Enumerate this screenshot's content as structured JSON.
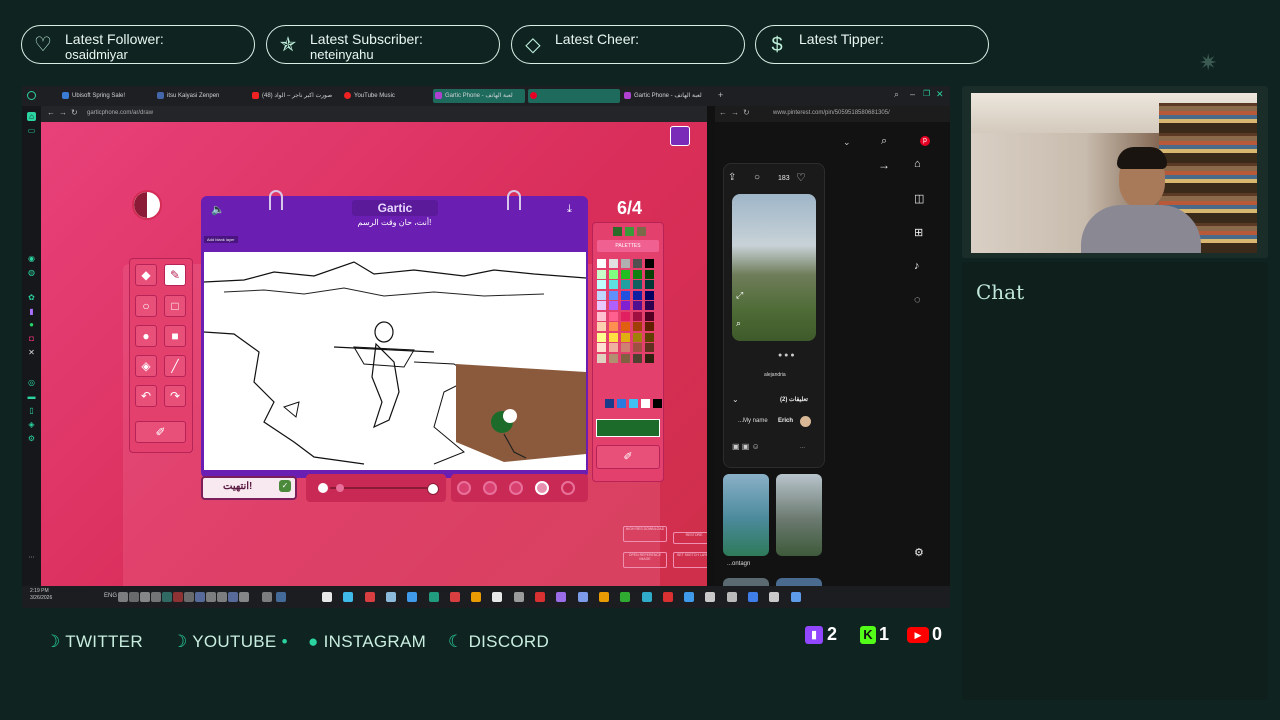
{
  "alerts": [
    {
      "label": "Latest Follower:",
      "value": "osaidmiyar",
      "icon": "heart-icon",
      "glyph": "♡"
    },
    {
      "label": "Latest Subscriber:",
      "value": "neteinyahu",
      "icon": "star-icon",
      "glyph": "✯"
    },
    {
      "label": "Latest Cheer:",
      "value": "",
      "icon": "diamond-icon",
      "glyph": "◇"
    },
    {
      "label": "Latest Tipper:",
      "value": "",
      "icon": "dollar-icon",
      "glyph": "$"
    }
  ],
  "browser": {
    "tabs": [
      "Ubisoft Spring Sale!",
      "itsu Kaiyasi Zenpen",
      "(48) صورت اكبر ناجر – الواد",
      "YouTube Music",
      "Gartic Phone - لعبة الهاتف",
      "",
      "Gartic Phone - لعبة الهاتف"
    ],
    "gartic_url": "garticphone.com/ar/draw",
    "pinterest_url": "www.pinterest.com/pin/5059518580681305/"
  },
  "gartic": {
    "logo": "Gartic",
    "prompt": "أنت، حان وقت الرسم!",
    "counter": "6/4",
    "palettes_label": "PALETTES",
    "done_button": "انتهيت!",
    "add_layer": "Add blank layer",
    "side_buttons": [
      "HIGH RES DOWNLOAD",
      "OPEN REFERENCE IMAGE",
      "RESTORE",
      "SET SKETCH LAYER"
    ]
  },
  "pinterest": {
    "likes": "183",
    "user": "alejandria",
    "comments_header": "تعليقات (2)",
    "comment_name": "Erich",
    "comment_text": "...My name",
    "reply_hint": "...",
    "thumb_caption": "...ontagn"
  },
  "taskbar": {
    "time": "2:19 PM",
    "date": "3/26/2026",
    "lang": "ENG"
  },
  "socials": [
    "TWITTER",
    "YOUTUBE",
    "INSTAGRAM",
    "DISCORD"
  ],
  "counts": {
    "twitch": "2",
    "kick": "1",
    "youtube": "0"
  },
  "chat": {
    "title": "Chat"
  },
  "colors": {
    "accent": "#2ad3a0",
    "gartic_purple": "#6a1fb2",
    "gartic_pink": "#e8417a",
    "bg": "#0f2320"
  }
}
